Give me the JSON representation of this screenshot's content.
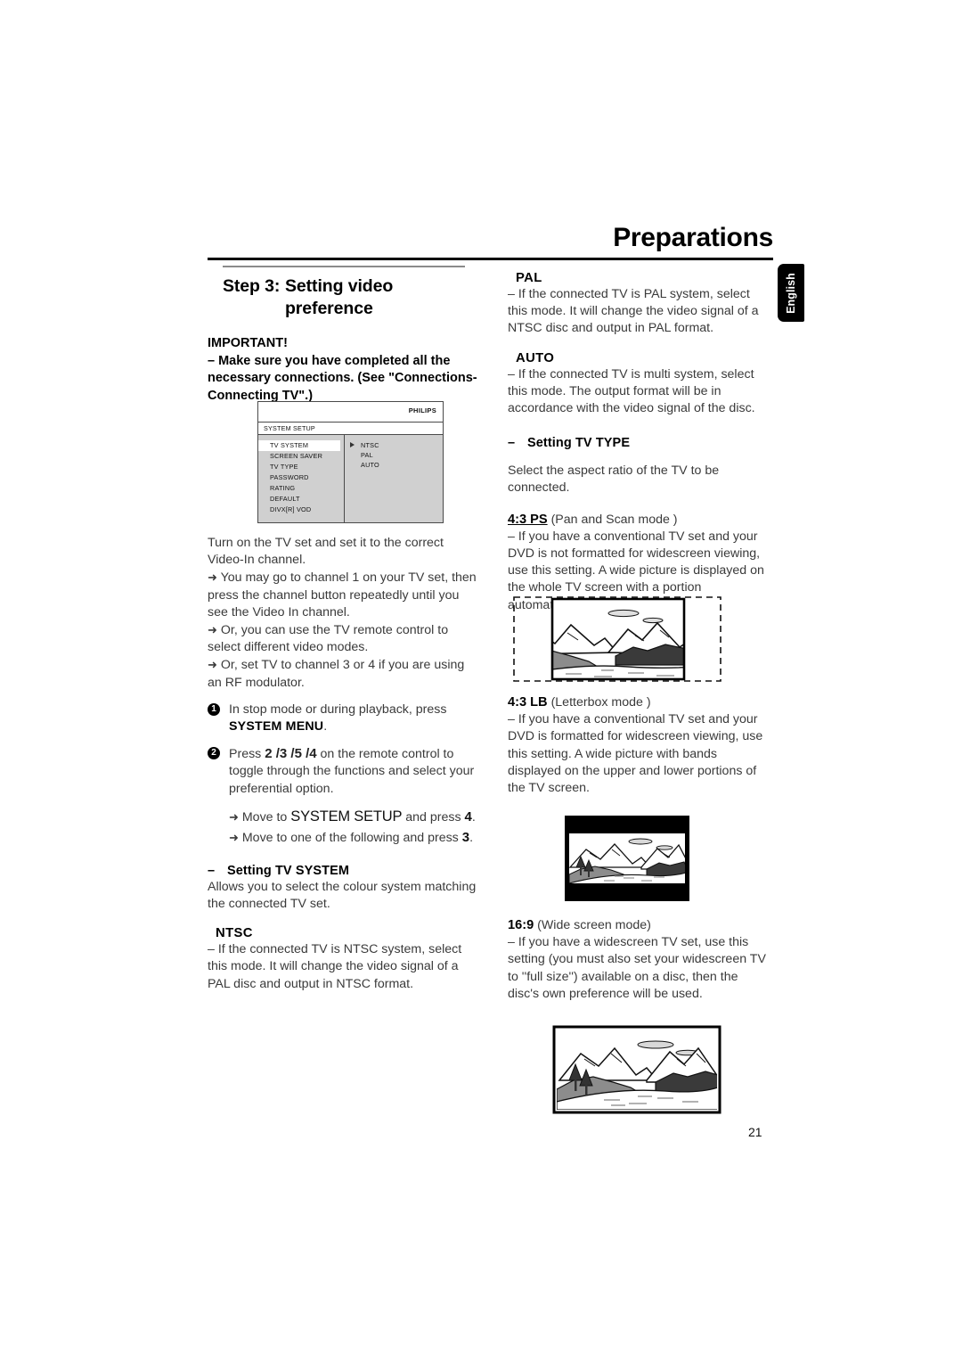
{
  "header": {
    "title": "Preparations",
    "language_tab": "English",
    "page_number": "21"
  },
  "left_column": {
    "step_label": "Step 3:",
    "step_title_line1": "Setting video",
    "step_title_line2": "preference",
    "important_title": "IMPORTANT!",
    "important_body": "– Make sure you have completed all the necessary connections. (See \"Connections-Connecting TV\".)",
    "tv_setup_para": "Turn on the TV set and set it to the correct Video-In channel.",
    "arrow_items": [
      "You may go to channel 1 on your TV set, then press the channel button repeatedly until you see the Video In channel.",
      "Or, you can use the TV remote control to select different video modes.",
      "Or, set TV to channel 3 or 4 if you are using an RF modulator."
    ],
    "steps": [
      {
        "number": "1",
        "text_before": "In stop mode or during playback, press",
        "bold": "SYSTEM MENU",
        "text_after": "."
      },
      {
        "number": "2",
        "text_before": "Press",
        "keys": "2 /3 /5 /4",
        "text_after": "on the remote control to toggle through the functions and select your preferential option."
      }
    ],
    "sub_arrows": [
      {
        "pre": "Move to",
        "big": "SYSTEM SETUP",
        "mid": "and press",
        "key": "4",
        "post": "."
      },
      {
        "pre": "Move to one of the following and press",
        "big": "",
        "mid": "",
        "key": "3",
        "post": "."
      }
    ],
    "tv_system": {
      "dash": "–",
      "heading": "Setting TV SYSTEM",
      "description": "Allows you to select the colour system matching the connected TV set.",
      "ntsc_term": "NTSC",
      "ntsc_desc": "–   If the connected TV is NTSC system, select this mode. It will change the video signal of a PAL disc and output in NTSC format."
    }
  },
  "osd_menu": {
    "brand": "PHILIPS",
    "title": "SYSTEM SETUP",
    "items": [
      "TV SYSTEM",
      "SCREEN SAVER",
      "TV TYPE",
      "PASSWORD",
      "RATING",
      "DEFAULT",
      "DIVX[R] VOD"
    ],
    "selected_item": "TV SYSTEM",
    "options": [
      "NTSC",
      "PAL",
      "AUTO"
    ]
  },
  "right_column": {
    "pal_term": "PAL",
    "pal_desc": "–   If the connected TV is PAL system, select this mode. It will change the video signal of a NTSC disc and output in PAL format.",
    "auto_term": "AUTO",
    "auto_desc": "–   If the connected TV is multi system, select this mode. The output format will be in accordance with the video signal of the disc.",
    "tv_type": {
      "dash": "–",
      "heading": "Setting TV TYPE",
      "intro": "Select the aspect ratio of the TV to be connected.",
      "modes": [
        {
          "key": "4:3 PS",
          "key_underlined": true,
          "paren": "(Pan and Scan mode )",
          "desc": "–   If you have a conventional TV set and your DVD is not formatted for widescreen viewing, use this setting. A wide picture is displayed on the whole TV screen with a portion automatically cut off.",
          "illustration": "pan-and-scan-tv-illustration"
        },
        {
          "key": "4:3 LB",
          "key_underlined": false,
          "paren": "(Letterbox mode )",
          "desc": "–   If you have a conventional TV set and your DVD is formatted for widescreen viewing, use this setting. A wide picture with bands displayed on the upper and lower portions of the TV screen.",
          "illustration": "letterbox-tv-illustration"
        },
        {
          "key": "16:9",
          "key_underlined": false,
          "paren": "(Wide screen mode)",
          "desc": "–   If you have a widescreen TV set, use this setting (you must also set your widescreen TV to ''full size'') available on a disc, then the disc's own preference will be used.",
          "illustration": "widescreen-tv-illustration"
        }
      ]
    }
  }
}
